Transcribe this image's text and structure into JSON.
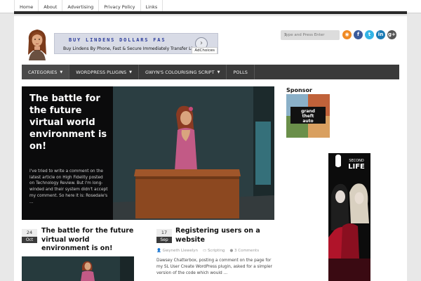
{
  "topnav": [
    "Home",
    "About",
    "Advertising",
    "Privacy Policy",
    "Links"
  ],
  "ad": {
    "title": "BUY LINDENS DOLLARS FAS",
    "subtitle": "Buy Lindens By Phone, Fast & Secure Immediately Transfer Lindens",
    "adchoices": "AdChoices"
  },
  "search": {
    "placeholder": "Type and Press Enter"
  },
  "social": [
    {
      "icon": "rss-icon",
      "glyph": "◉",
      "color": "#f08a24"
    },
    {
      "icon": "facebook-icon",
      "glyph": "f",
      "color": "#3b5a9a"
    },
    {
      "icon": "twitter-icon",
      "glyph": "t",
      "color": "#33b5e6"
    },
    {
      "icon": "linkedin-icon",
      "glyph": "in",
      "color": "#1b7bb5"
    },
    {
      "icon": "googleplus-icon",
      "glyph": "g+",
      "color": "#555555"
    }
  ],
  "mainnav": [
    {
      "label": "CATEGORIES",
      "dropdown": true
    },
    {
      "label": "WORDPRESS PLUGINS",
      "dropdown": true
    },
    {
      "label": "GWYN'S COLOURISING SCRIPT",
      "dropdown": true
    },
    {
      "label": "POLLS",
      "dropdown": false
    }
  ],
  "featured": {
    "title": "The battle for the future virtual world environment is on!",
    "excerpt": "I've tried to write a comment on the latest article on High Fidelity posted on Technology Review. But I'm long-winded and their system didn't accept my comment. So here it is: Rosedale's ..."
  },
  "posts": [
    {
      "day": "24",
      "month": "Oct",
      "title": "The battle for the future virtual world environment is on!"
    },
    {
      "day": "17",
      "month": "Sep",
      "title": "Registering users on a website",
      "author": "Gwyneth Llewelyn",
      "category": "Scripting",
      "comments": "3 Comments",
      "excerpt": "Dawsey Chatterbox, posting a comment on the page for my SL User Create WordPress plugin, asked for a simpler version of the code which would ..."
    }
  ],
  "sidebar": {
    "sponsor_label": "Sponsor",
    "sponsor_logo_text": "grand theft auto",
    "sl_logo_text": "SECOND LIFE"
  },
  "colors": {
    "nav_bg": "#3a3a3a",
    "ad_title": "#2a3a9a",
    "topbar_rule": "#2a2a2a"
  }
}
